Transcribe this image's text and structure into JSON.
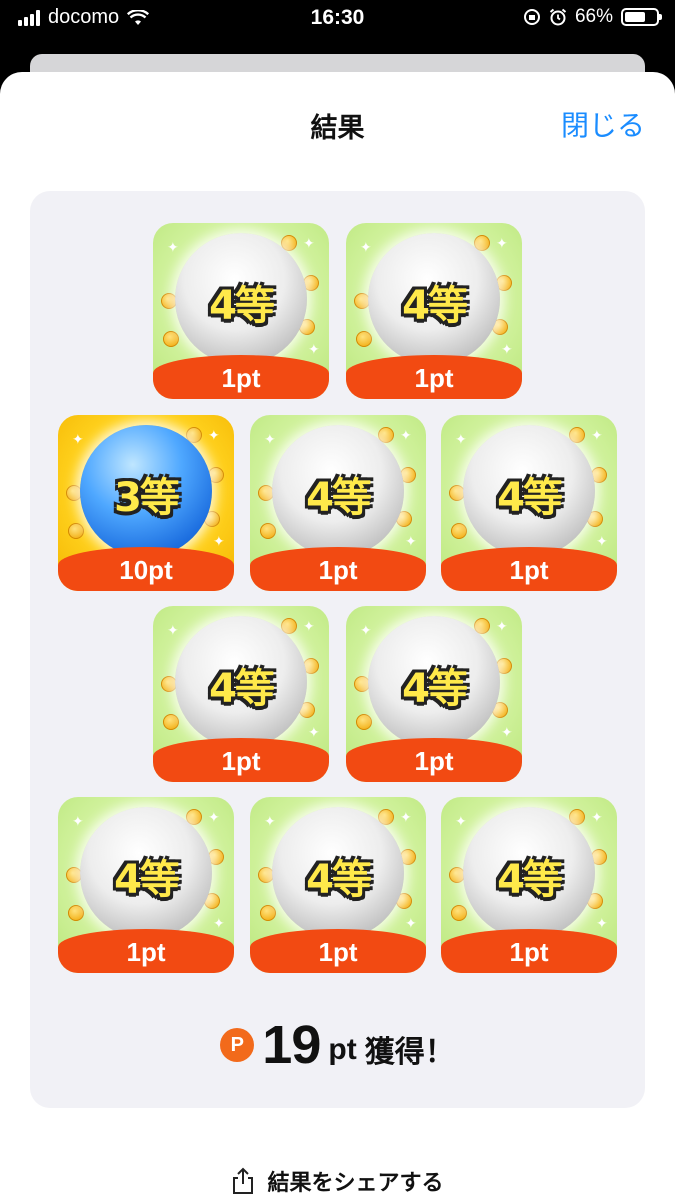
{
  "status_bar": {
    "carrier": "docomo",
    "time": "16:30",
    "battery": "66%",
    "battery_level": 0.66,
    "icons": [
      "signal-icon",
      "wifi-icon",
      "orientation-lock-icon",
      "alarm-icon",
      "battery-icon"
    ]
  },
  "sheet": {
    "title": "結果",
    "close_label": "閉じる"
  },
  "tiles": [
    {
      "rank": "4等",
      "points": "1pt",
      "style": "green"
    },
    {
      "rank": "4等",
      "points": "1pt",
      "style": "green"
    },
    {
      "rank": "3等",
      "points": "10pt",
      "style": "gold"
    },
    {
      "rank": "4等",
      "points": "1pt",
      "style": "green"
    },
    {
      "rank": "4等",
      "points": "1pt",
      "style": "green"
    },
    {
      "rank": "4等",
      "points": "1pt",
      "style": "green"
    },
    {
      "rank": "4等",
      "points": "1pt",
      "style": "green"
    },
    {
      "rank": "4等",
      "points": "1pt",
      "style": "green"
    },
    {
      "rank": "4等",
      "points": "1pt",
      "style": "green"
    },
    {
      "rank": "4等",
      "points": "1pt",
      "style": "green"
    }
  ],
  "total": {
    "icon_letter": "P",
    "amount": "19",
    "unit": "pt",
    "suffix": "獲得！"
  },
  "share": {
    "label": "結果をシェアする"
  },
  "colors": {
    "accent_blue": "#1a8cff",
    "points_orange": "#f24a12",
    "panel_bg": "#f1f1f6"
  }
}
